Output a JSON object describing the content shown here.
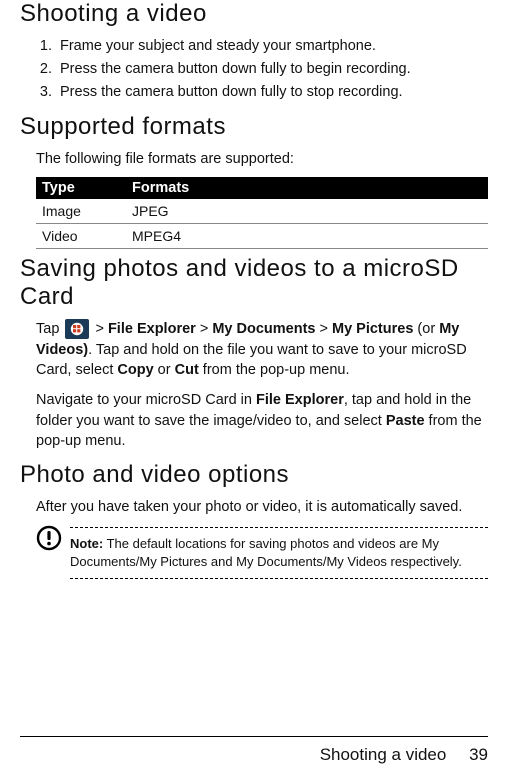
{
  "section1": {
    "title": "Shooting a video",
    "steps": [
      "Frame your subject and steady your smartphone.",
      "Press the camera button down fully to begin recording.",
      "Press the camera button down fully to stop recording."
    ]
  },
  "section2": {
    "title": "Supported formats",
    "intro": "The following file formats are supported:",
    "table": {
      "headers": [
        "Type",
        "Formats"
      ],
      "rows": [
        [
          "Image",
          "JPEG"
        ],
        [
          "Video",
          "MPEG4"
        ]
      ]
    }
  },
  "section3": {
    "title": "Saving photos and videos to a microSD Card",
    "p1_pre": "Tap ",
    "p1_seq": [
      " > ",
      "File Explorer",
      " > ",
      "My Documents",
      " > ",
      "My Pictures",
      " (or ",
      "My Videos)",
      ". Tap and hold on the file you want to save to your microSD Card, select ",
      "Copy",
      " or ",
      "Cut",
      " from the pop-up menu."
    ],
    "p2_seq": [
      "Navigate to your microSD Card in ",
      "File Explorer",
      ", tap and hold in the folder you want to save the image/video to, and select ",
      "Paste",
      " from the pop-up menu."
    ]
  },
  "section4": {
    "title": "Photo and video options",
    "p1": "After you have taken your photo or video, it is automatically saved.",
    "note_label": "Note:",
    "note_text": " The default locations for saving photos and videos are My Documents/My Pictures and My Documents/My Videos respectively."
  },
  "footer": {
    "title": "Shooting a video",
    "page": "39"
  }
}
